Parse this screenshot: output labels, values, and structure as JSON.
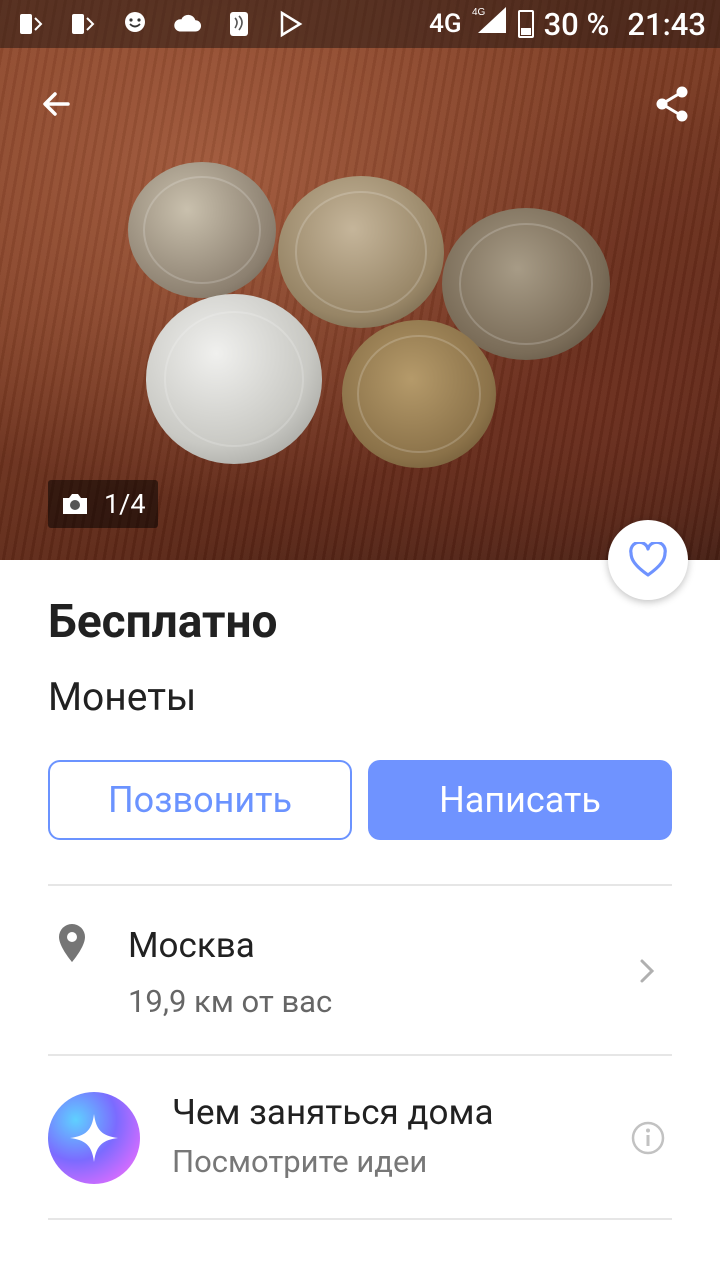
{
  "status_bar": {
    "network": "4G",
    "network_sup": "4G",
    "battery": "30 %",
    "time": "21:43"
  },
  "photo": {
    "counter": "1/4"
  },
  "listing": {
    "price": "Бесплатно",
    "title": "Монеты"
  },
  "actions": {
    "call_label": "Позвонить",
    "write_label": "Написать"
  },
  "location": {
    "city": "Москва",
    "distance": "19,9 км от вас"
  },
  "promo": {
    "title": "Чем заняться дома",
    "subtitle": "Посмотрите идеи"
  },
  "colors": {
    "accent": "#6f93ff",
    "text": "#212121",
    "secondary_text": "#666666"
  }
}
